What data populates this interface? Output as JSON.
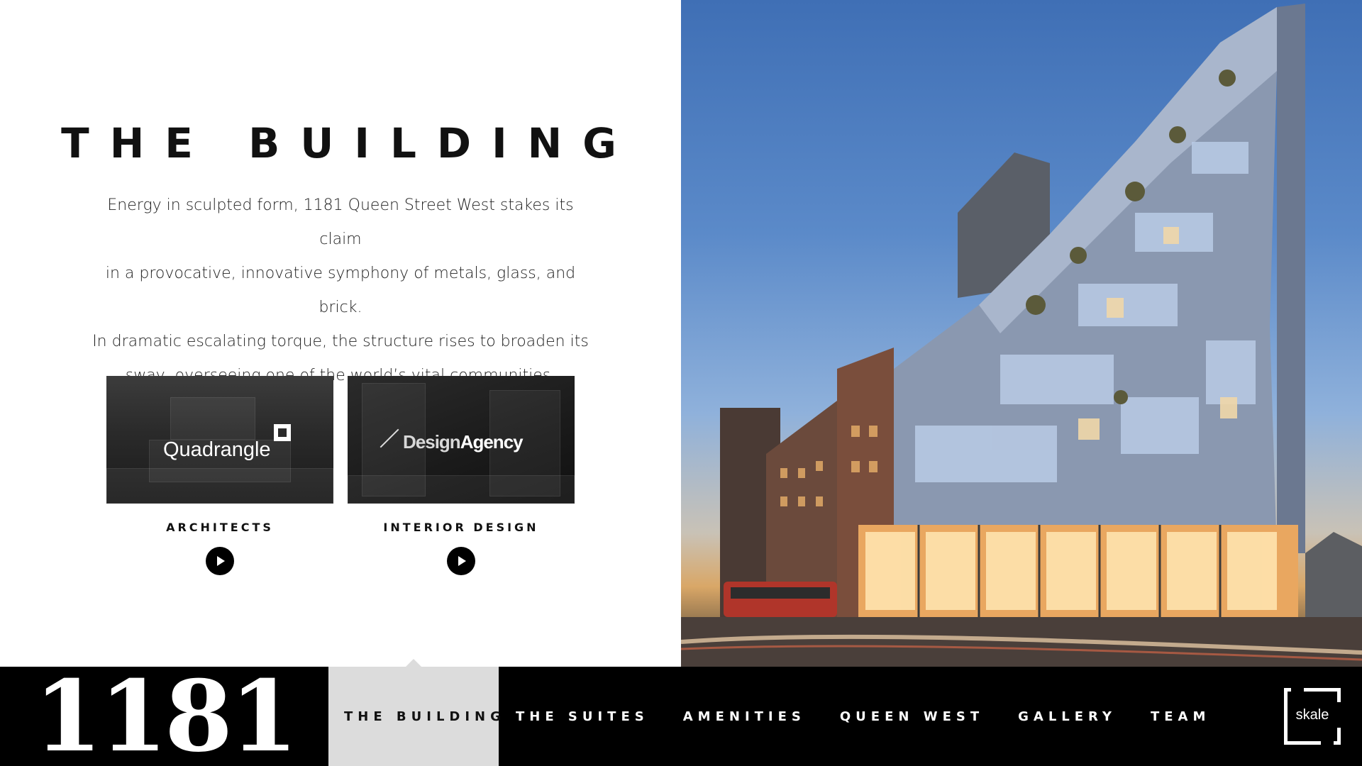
{
  "page": {
    "title": "THE BUILDING",
    "intro_lines": [
      "Energy in sculpted form, 1181 Queen Street West stakes its claim",
      "in a provocative, innovative symphony of metals, glass, and brick.",
      "In dramatic escalating torque, the structure rises to broaden its",
      "sway, overseeing one of the world’s vital communities."
    ]
  },
  "cards": [
    {
      "brand": "Quadrangle",
      "label": "ARCHITECTS"
    },
    {
      "brand_part1": "Design",
      "brand_part2": "Agency",
      "label": "INTERIOR DESIGN"
    }
  ],
  "nav": {
    "logo": "1181",
    "items": [
      {
        "label": "THE BUILDING",
        "active": true
      },
      {
        "label": "THE SUITES",
        "active": false
      },
      {
        "label": "AMENITIES",
        "active": false
      },
      {
        "label": "QUEEN WEST",
        "active": false
      },
      {
        "label": "GALLERY",
        "active": false
      },
      {
        "label": "TEAM",
        "active": false
      }
    ],
    "partner_logo": "skale"
  },
  "colors": {
    "nav_bg": "#000000",
    "active_tab_bg": "#dcdcdc",
    "text": "#111111"
  }
}
